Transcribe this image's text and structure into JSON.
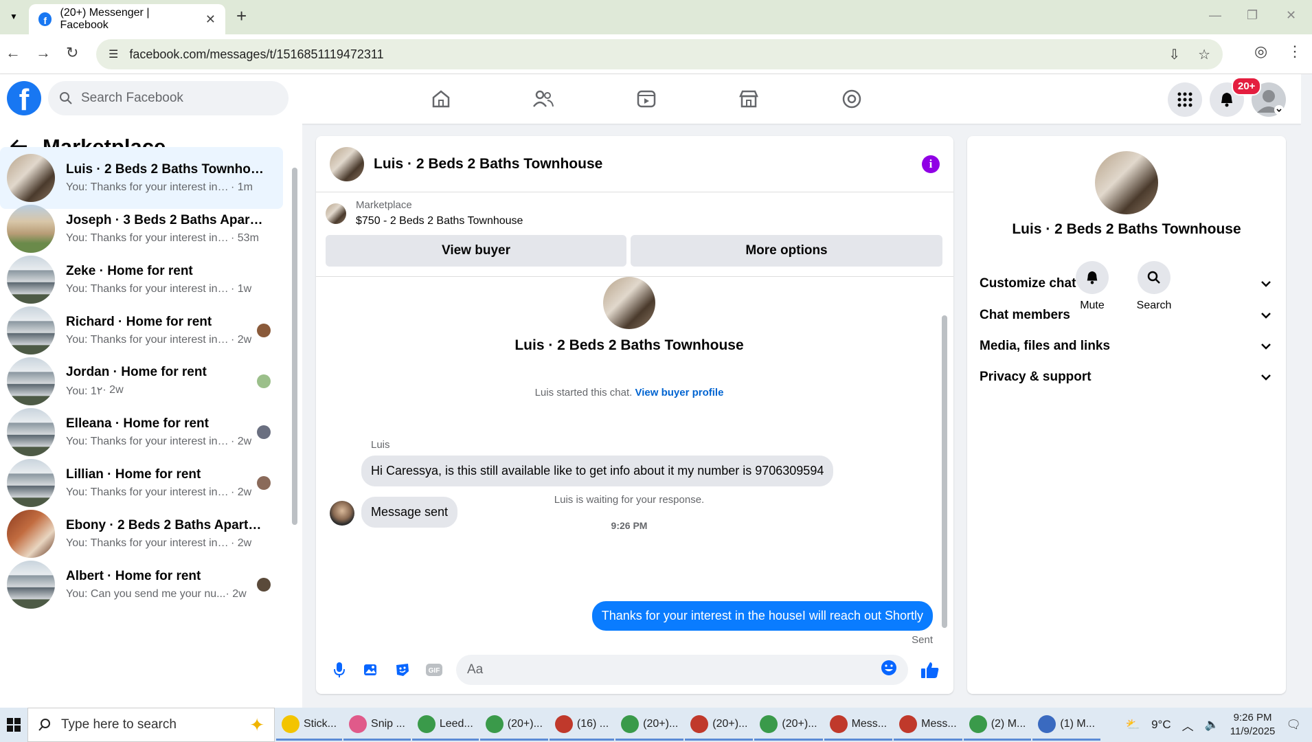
{
  "browser": {
    "tab_title": "(20+) Messenger | Facebook",
    "url": "facebook.com/messages/t/1516851119472311"
  },
  "fb": {
    "search_placeholder": "Search Facebook",
    "notif_badge": "20+"
  },
  "sidebar": {
    "title": "Marketplace",
    "conversations": [
      {
        "name": "Luis · 2 Beds 2 Baths Townhouse",
        "preview": "You: Thanks for your interest in the...",
        "time": "· 1m",
        "thumb": "bath",
        "active": true
      },
      {
        "name": "Joseph · 3 Beds 2 Baths Apartm...",
        "preview": "You: Thanks for your interest in t...",
        "time": "· 53m",
        "thumb": "house2"
      },
      {
        "name": "Zeke · Home for rent",
        "preview": "You: Thanks for your interest in the...",
        "time": "· 1w",
        "thumb": "house"
      },
      {
        "name": "Richard · Home for rent",
        "preview": "You: Thanks for your interest in t...",
        "time": "· 2w",
        "thumb": "house",
        "mini": "#8a5a3a"
      },
      {
        "name": "Jordan · Home for rent",
        "preview": "You: 1٢",
        "time": "· 2w",
        "thumb": "house",
        "mini": "#9bbf8a"
      },
      {
        "name": "Elleana · Home for rent",
        "preview": "You: Thanks for your interest in t...",
        "time": "· 2w",
        "thumb": "house",
        "mini": "#6a6f80"
      },
      {
        "name": "Lillian · Home for rent",
        "preview": "You: Thanks for your interest in t...",
        "time": "· 2w",
        "thumb": "house",
        "mini": "#8a6a5a"
      },
      {
        "name": "Ebony · 2 Beds 2 Baths Apartme...",
        "preview": "You: Thanks for your interest in the...",
        "time": "· 2w",
        "thumb": "kitchen"
      },
      {
        "name": "Albert · Home for rent",
        "preview": "You: Can you send me your nu...",
        "time": "· 2w",
        "thumb": "house",
        "mini": "#5a4a3a"
      }
    ]
  },
  "chat": {
    "title": "Luis · 2 Beds 2 Baths Townhouse",
    "marketplace_label": "Marketplace",
    "listing": "$750 - 2 Beds 2 Baths Townhouse",
    "view_buyer": "View buyer",
    "more_options": "More options",
    "started": "Luis started this chat.",
    "view_profile": "View buyer profile",
    "sender": "Luis",
    "msg1": "Hi Caressya, is this still available like to get info about it  my number is 9706309594",
    "msg2": "Message sent",
    "waiting": "Luis is waiting for your response.",
    "time": "9:26 PM",
    "outgoing": "Thanks for your interest in the houseI will reach out Shortly",
    "status": "Sent",
    "composer_placeholder": "Aa"
  },
  "details": {
    "name": "Luis · 2 Beds 2 Baths Townhouse",
    "mute": "Mute",
    "search": "Search",
    "sections": [
      "Customize chat",
      "Chat members",
      "Media, files and links",
      "Privacy & support"
    ]
  },
  "taskbar": {
    "search_placeholder": "Type here to search",
    "items": [
      {
        "label": "Stick...",
        "color": "#f3c400"
      },
      {
        "label": "Snip ...",
        "color": "#e05a8a"
      },
      {
        "label": "Leed...",
        "color": "#3a9a4a"
      },
      {
        "label": "(20+)...",
        "color": "#3a9a4a"
      },
      {
        "label": "(16) ...",
        "color": "#c0392b"
      },
      {
        "label": "(20+)...",
        "color": "#3a9a4a"
      },
      {
        "label": "(20+)...",
        "color": "#c0392b"
      },
      {
        "label": "(20+)...",
        "color": "#3a9a4a"
      },
      {
        "label": "Mess...",
        "color": "#c0392b"
      },
      {
        "label": "Mess...",
        "color": "#c0392b"
      },
      {
        "label": "(2) M...",
        "color": "#3a9a4a"
      },
      {
        "label": "(1) M...",
        "color": "#3a6ac0"
      }
    ],
    "weather": "9°C",
    "time": "9:26 PM",
    "date": "11/9/2025"
  }
}
